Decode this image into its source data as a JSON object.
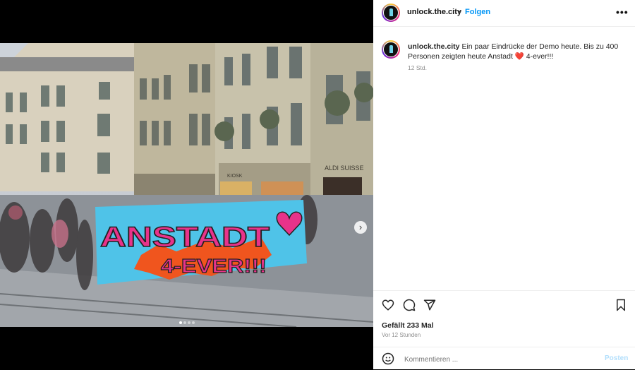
{
  "post": {
    "username": "unlock.the.city",
    "separator": "•",
    "follow_label": "Folgen",
    "caption_text": "Ein paar Eindrücke der Demo heute. Bis zu 400 Personen zeigten heute Anstadt",
    "caption_emoji": "❤️",
    "caption_suffix": "4-ever!!!",
    "caption_time": "12 Std.",
    "likes": "Gefällt 233 Mal",
    "time_ago": "Vor 12 Stunden"
  },
  "photo": {
    "banner_line1": "ANSTADT",
    "banner_line2": "4-EVER!!!",
    "store_sign": "ALDI SUISSE",
    "shop_sign_1": "KIOSK",
    "carousel_count": 4,
    "carousel_active": 1
  },
  "comment": {
    "placeholder": "Kommentieren ...",
    "post_label": "Posten"
  },
  "colors": {
    "link_blue": "#0095f6",
    "post_disabled": "#b2dffc",
    "banner_blue": "#4fc3e8",
    "banner_pink": "#e8338a",
    "banner_orange": "#f0551e"
  },
  "icons": [
    "heart-icon",
    "comment-icon",
    "share-icon",
    "bookmark-icon",
    "emoji-icon",
    "more-icon",
    "chevron-right-icon"
  ]
}
